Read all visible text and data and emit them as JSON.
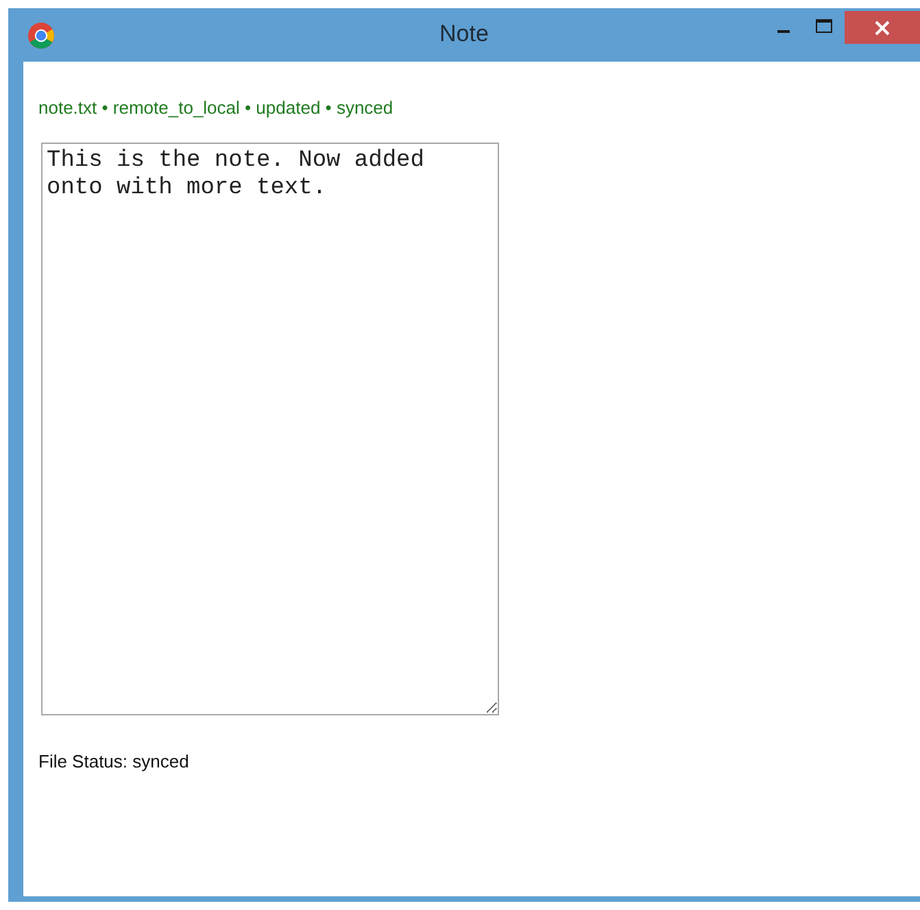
{
  "window": {
    "title": "Note"
  },
  "status_line": "note.txt • remote_to_local • updated • synced",
  "note": {
    "value": "This is the note. Now added onto with more text."
  },
  "file_status": "File Status: synced"
}
